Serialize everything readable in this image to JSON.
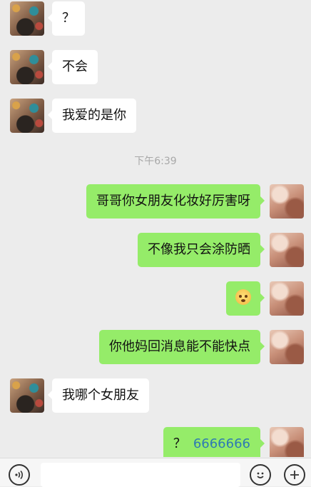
{
  "chat": {
    "messages": [
      {
        "side": "left",
        "text": "？"
      },
      {
        "side": "left",
        "text": "不会"
      },
      {
        "side": "left",
        "text": "我爱的是你"
      },
      {
        "side": "right",
        "text": "哥哥你女朋友化妆好厉害呀"
      },
      {
        "side": "right",
        "text": "不像我只会涂防晒"
      },
      {
        "side": "right",
        "emoji": "worried-face-icon"
      },
      {
        "side": "right",
        "text": "你他妈回消息能不能快点"
      },
      {
        "side": "left",
        "text": "我哪个女朋友"
      },
      {
        "side": "right",
        "text": "？",
        "link": "6666666"
      }
    ],
    "timestamp": "下午6:39"
  },
  "input_bar": {
    "text_value": "",
    "icons": [
      "voice-icon",
      "emoji-icon",
      "plus-icon"
    ]
  },
  "colors": {
    "background": "#ececec",
    "outgoing_bubble": "#95ec69",
    "incoming_bubble": "#ffffff",
    "link": "#2f7ab3",
    "timestamp": "#a8a8a8"
  }
}
